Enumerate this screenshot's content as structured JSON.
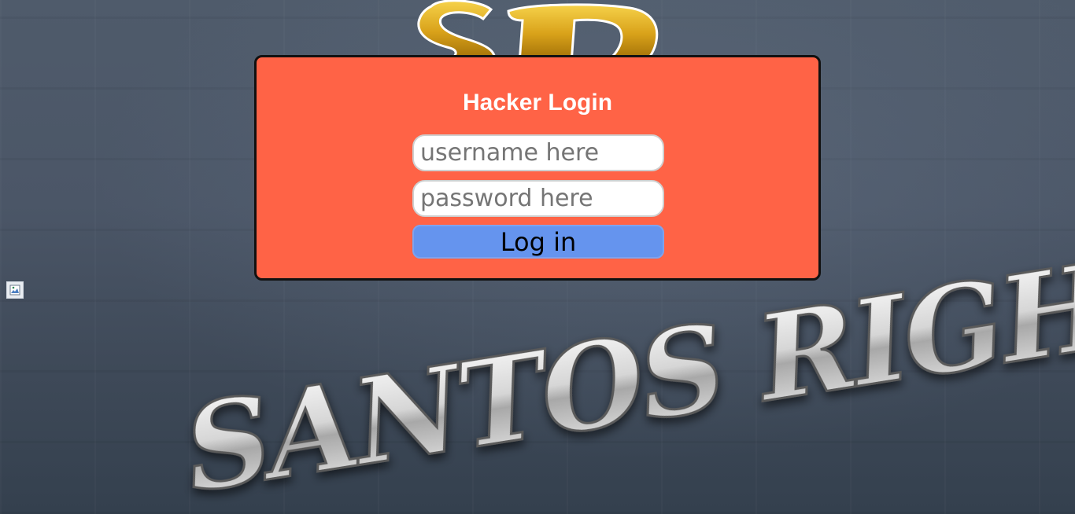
{
  "login": {
    "title": "Hacker Login",
    "username_placeholder": "username here",
    "password_placeholder": "password here",
    "username_value": "",
    "password_value": "",
    "submit_label": "Log in"
  },
  "branding": {
    "top_logo_text": "SR",
    "bottom_logo_text": "SANTOS RIGHT"
  },
  "broken_image_icon": "broken-image-icon",
  "colors": {
    "card_background": "#ff6346",
    "card_border": "#111111",
    "button_background": "#6594ee",
    "title_text": "#ffffff",
    "logo_gold": "#d9a21a",
    "logo_silver": "#e8e8e8"
  }
}
